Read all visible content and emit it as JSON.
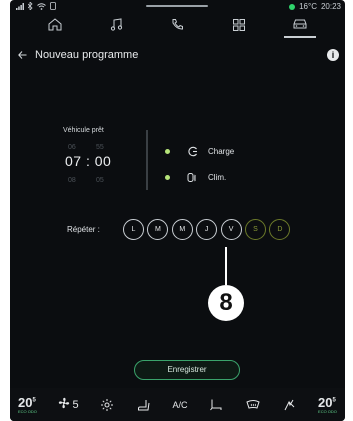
{
  "status": {
    "temperature": "16°C",
    "time": "20:23",
    "accent": "#2fd36b"
  },
  "nav": {
    "items": [
      {
        "name": "home-icon"
      },
      {
        "name": "music-icon"
      },
      {
        "name": "phone-icon"
      },
      {
        "name": "apps-icon"
      },
      {
        "name": "car-icon",
        "active": true
      }
    ]
  },
  "header": {
    "title": "Nouveau programme"
  },
  "ready": {
    "label": "Véhicule prêt",
    "hour_prev": "06",
    "min_prev": "55",
    "hour": "07",
    "separator": ":",
    "minute": "00",
    "hour_next": "08",
    "min_next": "05"
  },
  "options": [
    {
      "label": "Charge",
      "icon": "charge-icon"
    },
    {
      "label": "Clim.",
      "icon": "climate-icon"
    }
  ],
  "repeat": {
    "label": "Répéter :",
    "days": [
      "L",
      "M",
      "M",
      "J",
      "V",
      "S",
      "D"
    ]
  },
  "callout": {
    "number": "8"
  },
  "save": {
    "label": "Enregistrer"
  },
  "bottom": {
    "left_temp": "20",
    "left_temp_unit": "5",
    "left_sub": "ECO ODO",
    "fan_level": "5",
    "ac_label": "A/C",
    "right_temp": "20",
    "right_temp_unit": "5",
    "right_sub": "ECO ODO"
  }
}
